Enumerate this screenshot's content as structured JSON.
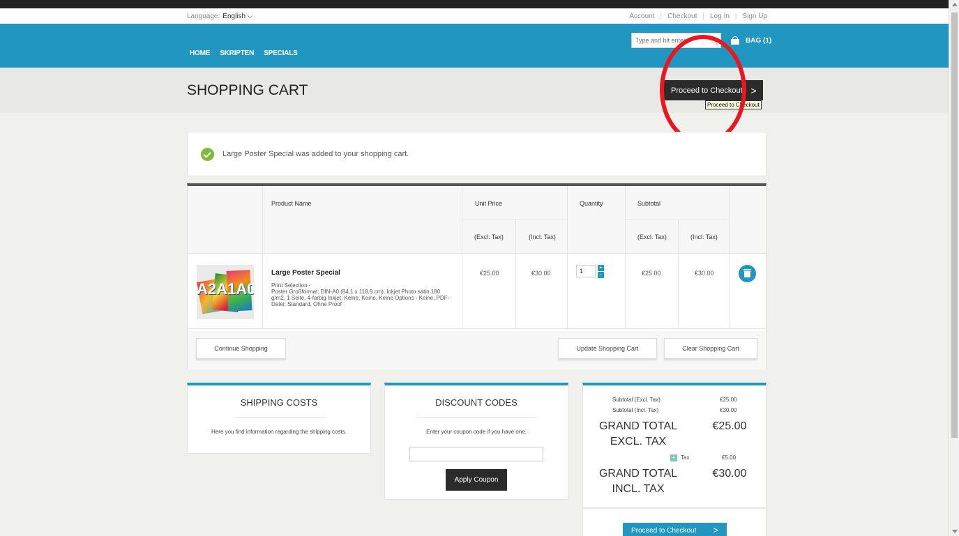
{
  "util": {
    "language_label": "Language:",
    "language_value": "English ⌵",
    "links": [
      "Account",
      "Checkout",
      "Log In",
      "Sign Up"
    ]
  },
  "nav": [
    "HOME",
    "SKRIPTEN",
    "SPECIALS"
  ],
  "search": {
    "placeholder": "Type and hit enter"
  },
  "bag": {
    "label": "BAG (1)"
  },
  "page": {
    "title": "SHOPPING CART",
    "checkout_button": "Proceed to Checkout",
    "tooltip": "Proceed to Checkout"
  },
  "message": "Large Poster Special was added to your shopping cart.",
  "cart": {
    "headers": {
      "product": "Product Name",
      "unit_price": "Unit Price",
      "quantity": "Quantity",
      "subtotal": "Subtotal",
      "excl": "(Excl. Tax)",
      "incl": "(Incl. Tax)"
    },
    "item": {
      "name": "Large Poster Special",
      "image_text": "A2A1A0",
      "options": "Print Selection -\nPoster Großformat: DIN-A0 (84,1 x 118,9 cm), Inkjet Photo satin 180 g/m2, 1 Seite, 4-farbig Inkjet, Keine, Keine, Keine Options - Keine, PDF-Datei, Standard, Ohne Proof",
      "unit_excl": "€25.00",
      "unit_incl": "€30.00",
      "qty": "1",
      "sub_excl": "€25.00",
      "sub_incl": "€30.00"
    },
    "buttons": {
      "continue": "Continue Shopping",
      "update": "Update Shopping Cart",
      "clear": "Clear Shopping Cart"
    }
  },
  "shipping": {
    "title": "SHIPPING COSTS",
    "text": "Here you find information regarding the shipping costs."
  },
  "discount": {
    "title": "DISCOUNT CODES",
    "text": "Enter your coupon code if you have one.",
    "button": "Apply Coupon"
  },
  "totals": {
    "subtotal_excl_label": "Subtotal (Excl. Tax)",
    "subtotal_excl": "€25.00",
    "subtotal_incl_label": "Subtotal (Incl. Tax)",
    "subtotal_incl": "€30.00",
    "grand_excl_label": "GRAND TOTAL EXCL. TAX",
    "grand_excl": "€25.00",
    "tax_label": "Tax",
    "tax": "€5.00",
    "grand_incl_label": "GRAND TOTAL INCL. TAX",
    "grand_incl": "€30.00",
    "checkout_button": "Proceed to Checkout"
  },
  "colors": {
    "brand": "#2196c0",
    "dark": "#2b2b2b",
    "success": "#7dbb3a",
    "annotation": "#e8191e"
  }
}
